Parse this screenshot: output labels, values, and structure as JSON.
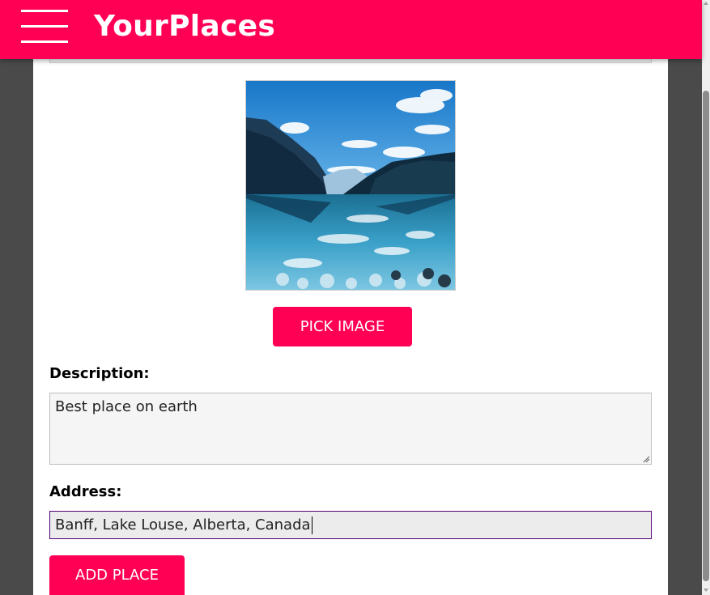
{
  "app": {
    "brand": "YourPlaces"
  },
  "form": {
    "image_button_label": "PICK IMAGE",
    "description_label": "Description:",
    "description_value": "Best place on earth",
    "address_label": "Address:",
    "address_value": "Banff, Lake Louse, Alberta, Canada",
    "submit_label": "ADD PLACE"
  },
  "image_preview": {
    "subject": "lake-mountains-photo"
  },
  "icons": {
    "menu": "hamburger-menu-icon",
    "resize": "resize-grip-icon"
  },
  "colors": {
    "accent": "#ff0055",
    "page_background": "#4a4a4a",
    "card_background": "#ffffff",
    "address_focus_border": "#510077"
  }
}
